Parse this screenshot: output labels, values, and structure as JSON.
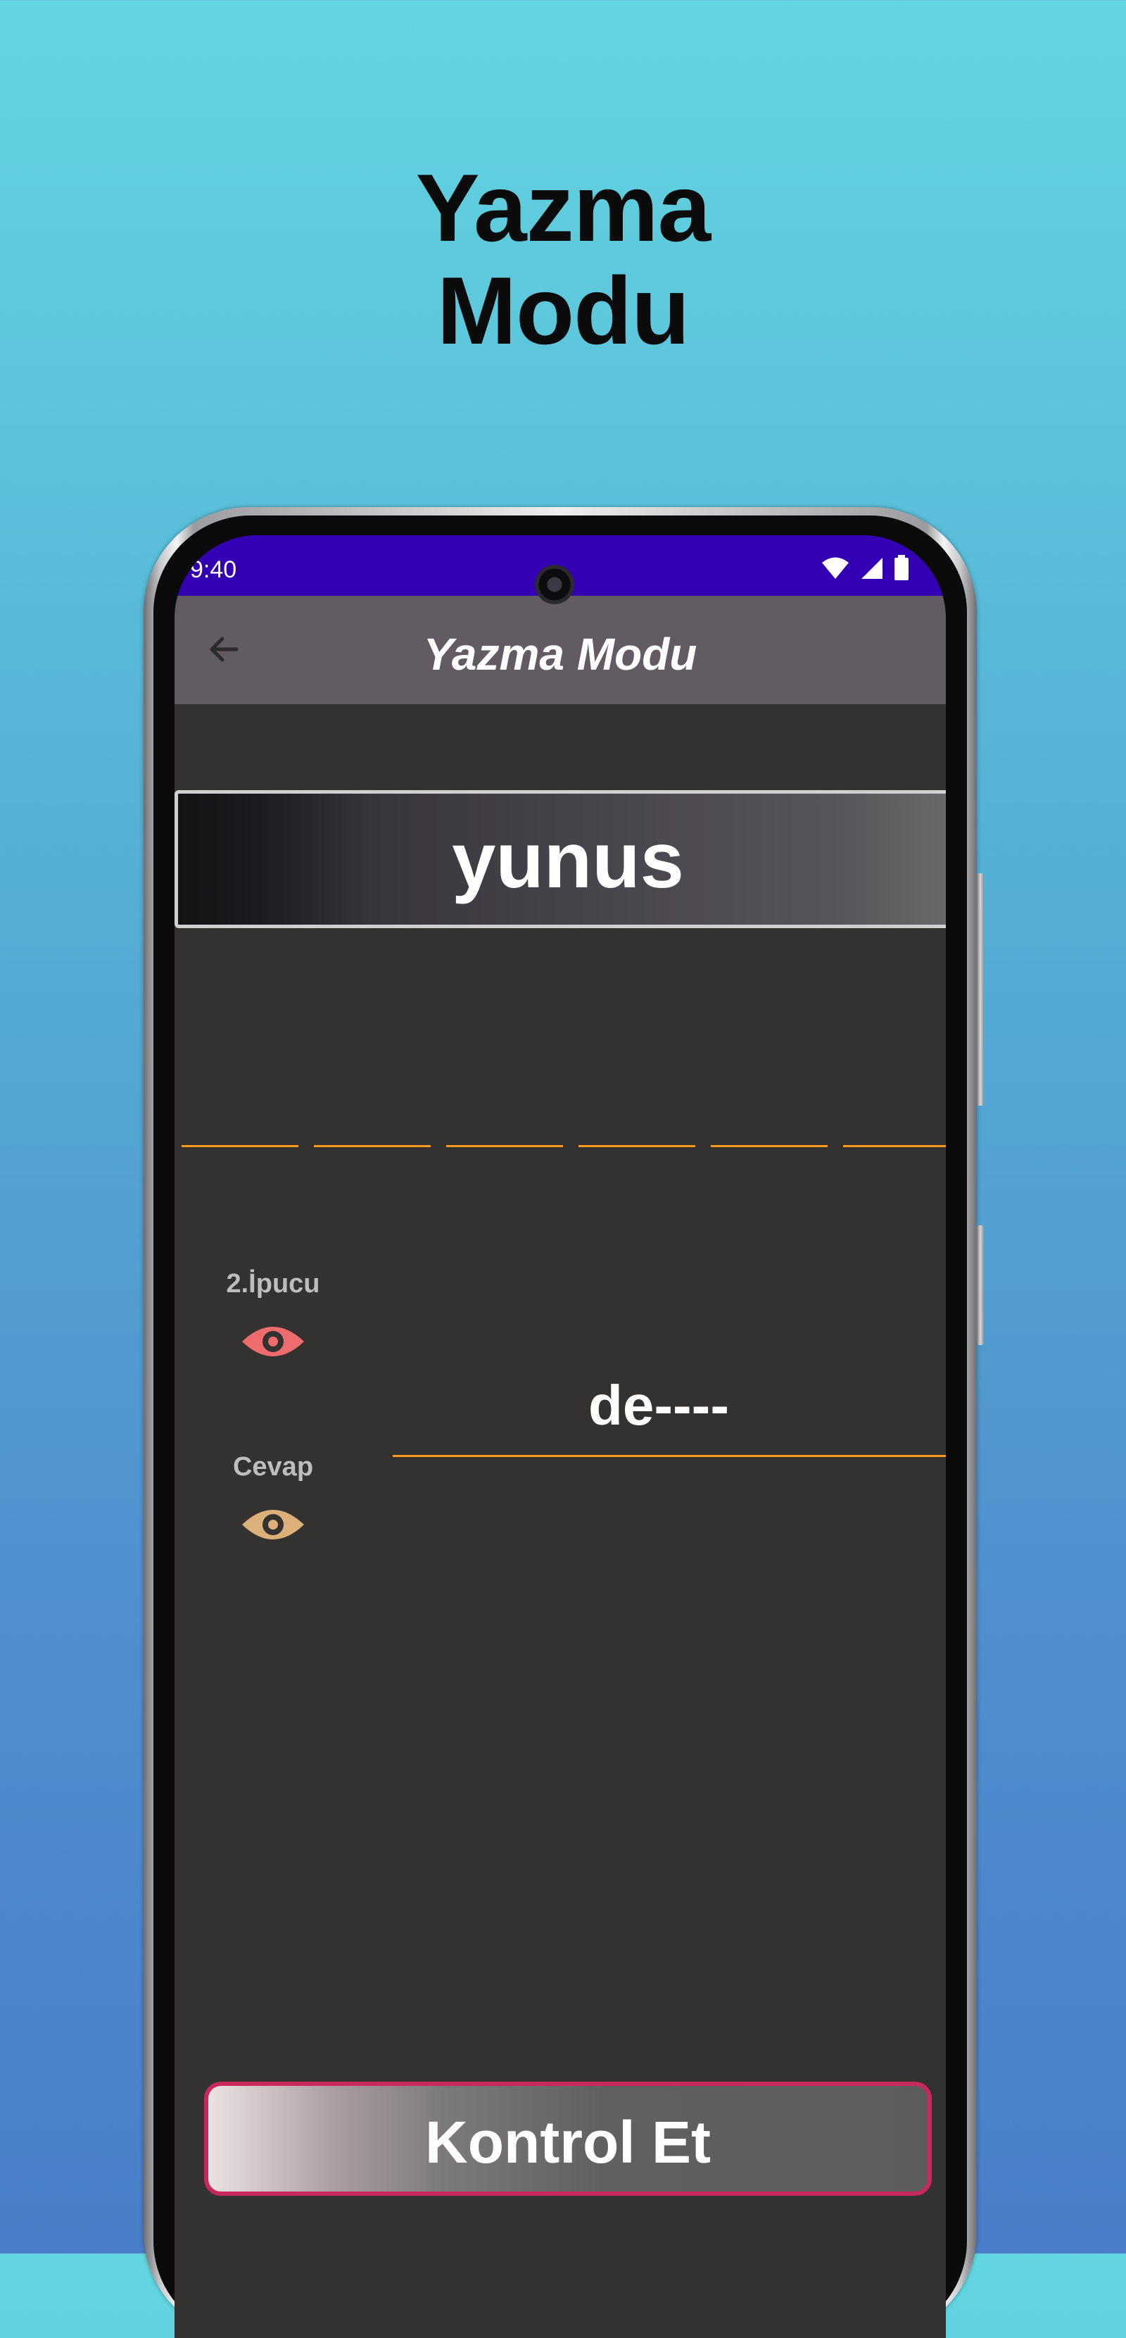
{
  "promo": {
    "title_line1": "Yazma",
    "title_line2": "Modu"
  },
  "status_bar": {
    "time": "9:40"
  },
  "app_bar": {
    "title": "Yazma Modu"
  },
  "word": "yunus",
  "letter_slots": 6,
  "hints": [
    {
      "label": "2.İpucu",
      "icon": "eye-icon",
      "color": "#ee6b6e"
    },
    {
      "label": "Cevap",
      "icon": "eye-icon",
      "color": "#dcb179"
    }
  ],
  "answer": "de----",
  "check_button": {
    "label": "Kontrol Et"
  },
  "colors": {
    "status_bar": "#3400b4",
    "app_bar": "#625b61",
    "screen_bg": "#333231",
    "line_accent": "#ff9a1e",
    "button_border": "#c8285e"
  }
}
